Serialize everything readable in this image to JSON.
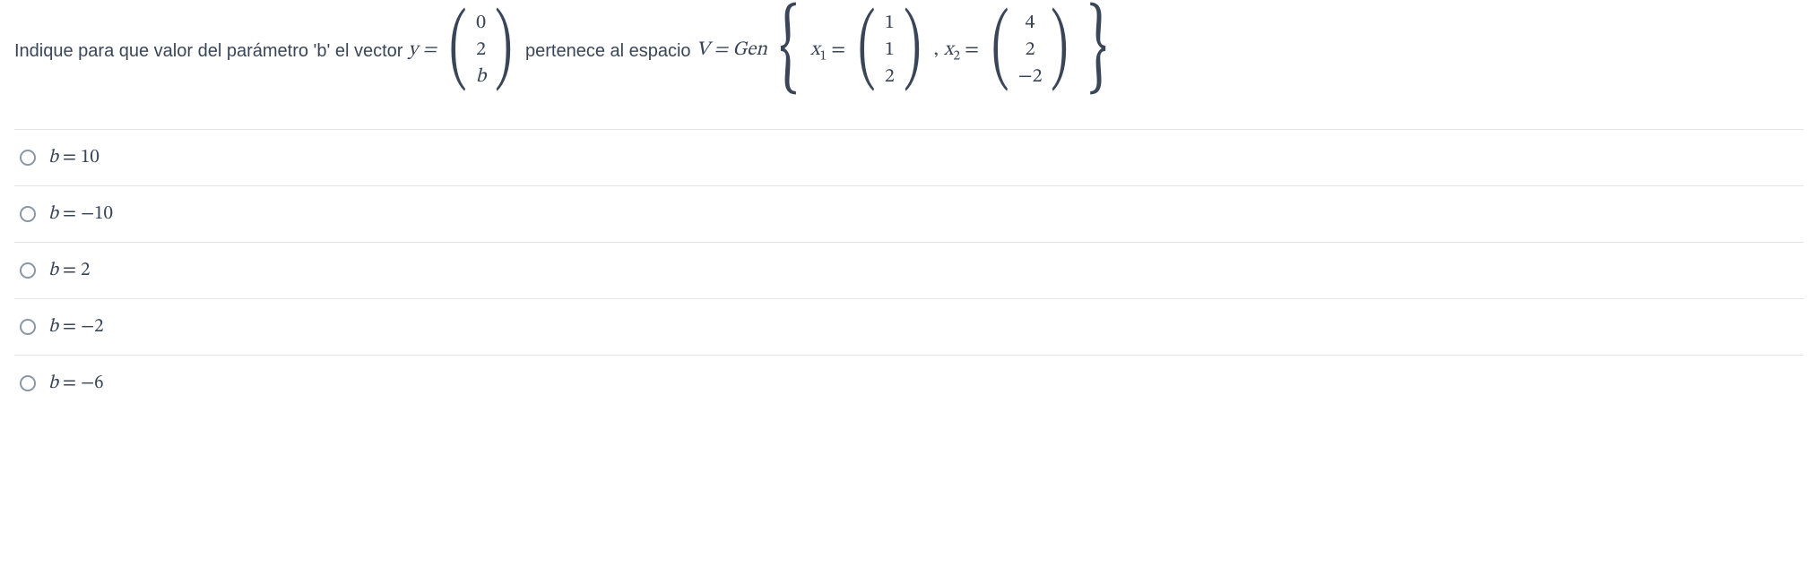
{
  "question": {
    "text_before": "Indique para que valor del parámetro 'b' el vector ",
    "y_equals": "y =",
    "vector_y": [
      "0",
      "2",
      "b"
    ],
    "text_mid": "pertenece al espacio ",
    "V_eq_Gen": "V = Gen",
    "x1_label": "x",
    "x1_sub": "1",
    "eq": " = ",
    "vector_x1": [
      "1",
      "1",
      "2"
    ],
    "comma": ", ",
    "x2_label": "x",
    "x2_sub": "2",
    "vector_x2": [
      "4",
      "2",
      "−2"
    ]
  },
  "options": [
    {
      "var": "b",
      "eq": " = ",
      "val": "10"
    },
    {
      "var": "b",
      "eq": " = ",
      "val": "−10"
    },
    {
      "var": "b",
      "eq": " = ",
      "val": "2"
    },
    {
      "var": "b",
      "eq": " = ",
      "val": "−2"
    },
    {
      "var": "b",
      "eq": " = ",
      "val": "−6"
    }
  ]
}
